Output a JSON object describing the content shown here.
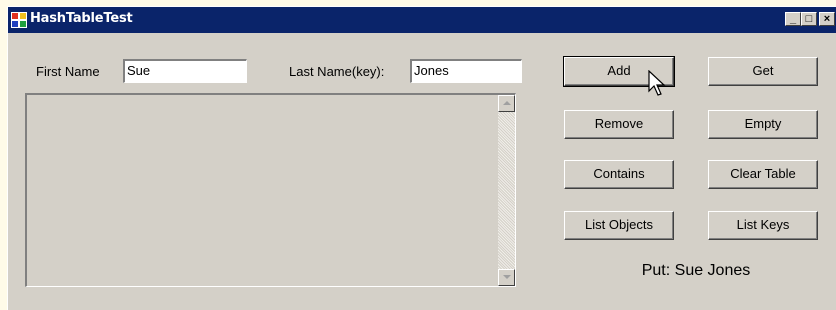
{
  "window": {
    "title": "HashTableTest",
    "controls": {
      "minimize": "_",
      "maximize": "□",
      "close": "×"
    }
  },
  "form": {
    "first_name_label": "First Name",
    "first_name_value": "Sue",
    "last_name_label": "Last Name(key):",
    "last_name_value": "Jones"
  },
  "buttons": {
    "add": "Add",
    "get": "Get",
    "remove": "Remove",
    "empty": "Empty",
    "contains": "Contains",
    "clear_table": "Clear Table",
    "list_objects": "List Objects",
    "list_keys": "List Keys"
  },
  "status": "Put: Sue Jones",
  "icons": {
    "app": "app-icon",
    "scroll_up": "arrow-up-icon",
    "scroll_down": "arrow-down-icon",
    "cursor": "mouse-pointer-icon"
  },
  "colors": {
    "title_bar": "#0a246a",
    "face": "#d4d0c8",
    "text_background": "#ffffff"
  }
}
